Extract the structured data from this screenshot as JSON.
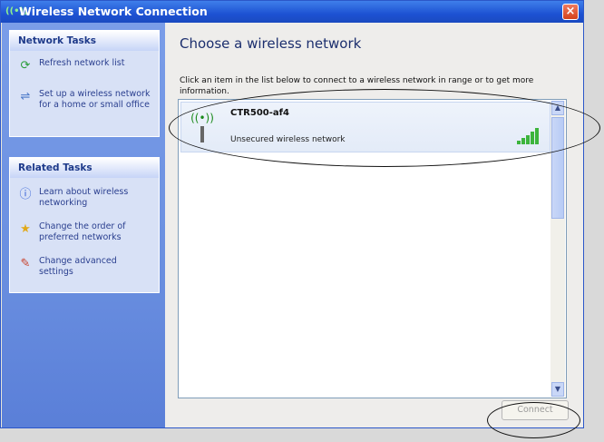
{
  "window": {
    "title": "Wireless Network Connection",
    "close_label": "×"
  },
  "sidebar": {
    "network_tasks": {
      "title": "Network Tasks",
      "items": [
        {
          "label": "Refresh network list",
          "icon": "refresh-icon"
        },
        {
          "label": "Set up a wireless network for a home or small office",
          "icon": "setup-network-icon"
        }
      ]
    },
    "related_tasks": {
      "title": "Related Tasks",
      "items": [
        {
          "label": "Learn about wireless networking",
          "icon": "help-icon"
        },
        {
          "label": "Change the order of preferred networks",
          "icon": "star-icon"
        },
        {
          "label": "Change advanced settings",
          "icon": "settings-icon"
        }
      ]
    }
  },
  "main": {
    "heading": "Choose a wireless network",
    "description": "Click an item in the list below to connect to a wireless network in range or to get more information.",
    "networks": [
      {
        "name": "CTR500-af4",
        "status": "Unsecured wireless network",
        "signal_bars": 5
      }
    ],
    "connect_label": "Connect"
  }
}
